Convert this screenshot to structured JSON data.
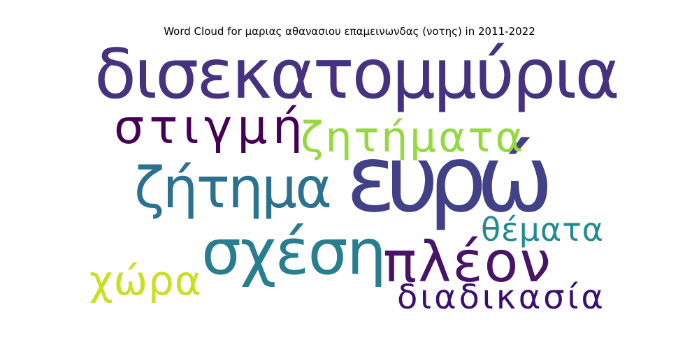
{
  "chart_data": {
    "type": "wordcloud",
    "title": "Word Cloud for μαριας αθανασιου επαμεινωνδας (νοτης) in 2011-2022",
    "words": [
      {
        "text": "δισεκατομμύρια",
        "color": "#46327e"
      },
      {
        "text": "ευρώ",
        "color": "#424086"
      },
      {
        "text": "στιγμή",
        "color": "#440154"
      },
      {
        "text": "ζητήματα",
        "color": "#95d840"
      },
      {
        "text": "ζήτημα",
        "color": "#2c728e"
      },
      {
        "text": "σχέση",
        "color": "#287d8e"
      },
      {
        "text": "πλέον",
        "color": "#481467"
      },
      {
        "text": "θέματα",
        "color": "#238a8d"
      },
      {
        "text": "χώρα",
        "color": "#c8e020"
      },
      {
        "text": "διαδικασία",
        "color": "#3b0f70"
      }
    ]
  }
}
